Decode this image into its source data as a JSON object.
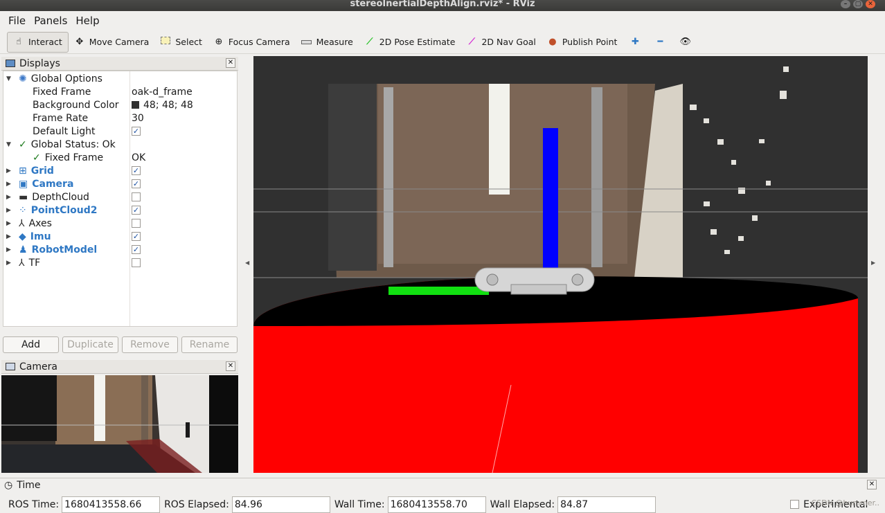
{
  "window": {
    "title": "stereoInertialDepthAlign.rviz* - RViz"
  },
  "menu": [
    "File",
    "Panels",
    "Help"
  ],
  "toolbar": {
    "interact": "Interact",
    "move_camera": "Move Camera",
    "select": "Select",
    "focus_camera": "Focus Camera",
    "measure": "Measure",
    "pose_estimate": "2D Pose Estimate",
    "nav_goal": "2D Nav Goal",
    "publish_point": "Publish Point"
  },
  "displays": {
    "title": "Displays",
    "global_options": "Global Options",
    "fixed_frame_label": "Fixed Frame",
    "fixed_frame_value": "oak-d_frame",
    "background_color_label": "Background Color",
    "background_color_value": "48; 48; 48",
    "frame_rate_label": "Frame Rate",
    "frame_rate_value": "30",
    "default_light_label": "Default Light",
    "global_status": "Global Status: Ok",
    "status_fixed_frame": "Fixed Frame",
    "status_value": "OK",
    "items": [
      {
        "label": "Grid",
        "checked": true,
        "highlight": true
      },
      {
        "label": "Camera",
        "checked": true,
        "highlight": true
      },
      {
        "label": "DepthCloud",
        "checked": false,
        "highlight": false
      },
      {
        "label": "PointCloud2",
        "checked": true,
        "highlight": true
      },
      {
        "label": "Axes",
        "checked": false,
        "highlight": false
      },
      {
        "label": "Imu",
        "checked": true,
        "highlight": true
      },
      {
        "label": "RobotModel",
        "checked": true,
        "highlight": true
      },
      {
        "label": "TF",
        "checked": false,
        "highlight": false
      }
    ],
    "buttons": {
      "add": "Add",
      "duplicate": "Duplicate",
      "remove": "Remove",
      "rename": "Rename"
    }
  },
  "camera_panel": {
    "title": "Camera"
  },
  "time": {
    "title": "Time",
    "ros_time_label": "ROS Time:",
    "ros_time": "1680413558.66",
    "ros_elapsed_label": "ROS Elapsed:",
    "ros_elapsed": "84.96",
    "wall_time_label": "Wall Time:",
    "wall_time": "1680413558.70",
    "wall_elapsed_label": "Wall Elapsed:",
    "wall_elapsed": "84.87",
    "experimental": "Experimental"
  },
  "watermark": "CSDN @hummer..",
  "colors": {
    "viewport_bg": "#303030",
    "link": "#2f78c4",
    "cylinder": "#ff0000",
    "axis_z": "#0000ff",
    "axis_x": "#00ff00"
  }
}
